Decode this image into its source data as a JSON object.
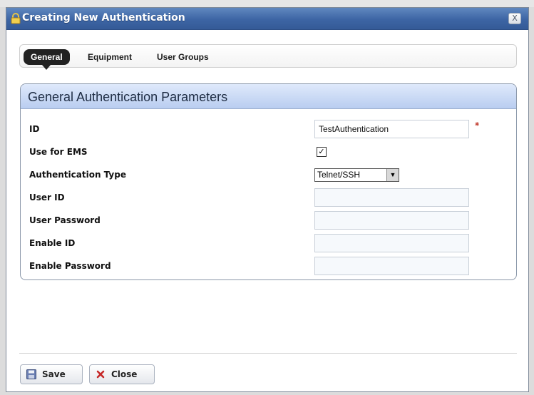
{
  "window": {
    "title": "Creating New Authentication",
    "close_label": "X"
  },
  "tabs": [
    {
      "label": "General",
      "active": true
    },
    {
      "label": "Equipment",
      "active": false
    },
    {
      "label": "User Groups",
      "active": false
    }
  ],
  "panel": {
    "title": "General Authentication Parameters",
    "fields": {
      "id": {
        "label": "ID",
        "value": "TestAuthentication",
        "required_marker": "*"
      },
      "use_for_ems": {
        "label": "Use for EMS",
        "checked": true,
        "check_glyph": "✓"
      },
      "auth_type": {
        "label": "Authentication Type",
        "selected": "Telnet/SSH",
        "arrow": "▼"
      },
      "user_id": {
        "label": "User ID",
        "value": ""
      },
      "user_password": {
        "label": "User Password",
        "value": ""
      },
      "enable_id": {
        "label": "Enable ID",
        "value": ""
      },
      "enable_password": {
        "label": "Enable Password",
        "value": ""
      }
    }
  },
  "footer": {
    "save_label": "Save",
    "close_label": "Close"
  },
  "icons": {
    "title": "lock-icon",
    "save": "floppy-disk-icon",
    "close": "red-x-icon",
    "required": "required-marker-icon"
  },
  "colors": {
    "titlebar": "#3d65a4",
    "panel_header": "#c9d9f4",
    "active_tab": "#222222"
  }
}
